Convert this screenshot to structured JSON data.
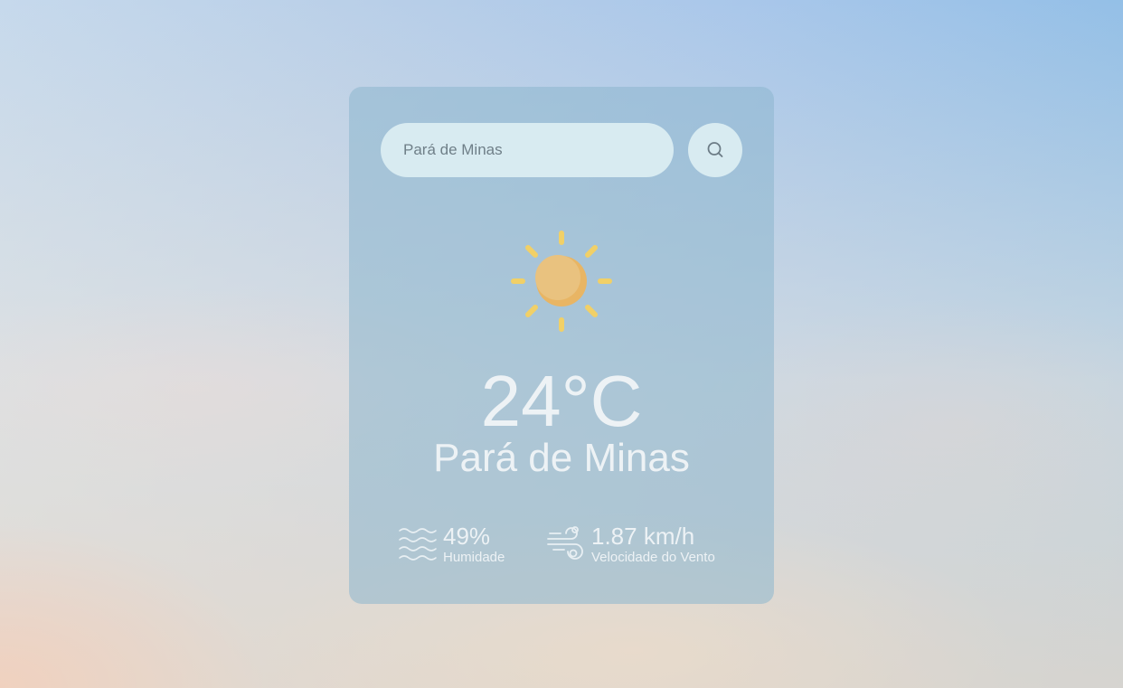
{
  "search": {
    "value": "Pará de Minas",
    "placeholder": "Pará de Minas"
  },
  "weather": {
    "icon": "sun-icon",
    "temperature": "24°C",
    "city": "Pará de Minas"
  },
  "details": {
    "humidity": {
      "icon": "humidity-waves-icon",
      "value": "49%",
      "label": "Humidade"
    },
    "wind": {
      "icon": "wind-icon",
      "value": "1.87 km/h",
      "label": "Velocidade do Vento"
    }
  },
  "colors": {
    "card": "#8cb6cd",
    "input_bg": "#d8ebf1",
    "text": "#edf2f5",
    "sun_core": "#e9c07e",
    "sun_rays": "#f1d067"
  }
}
